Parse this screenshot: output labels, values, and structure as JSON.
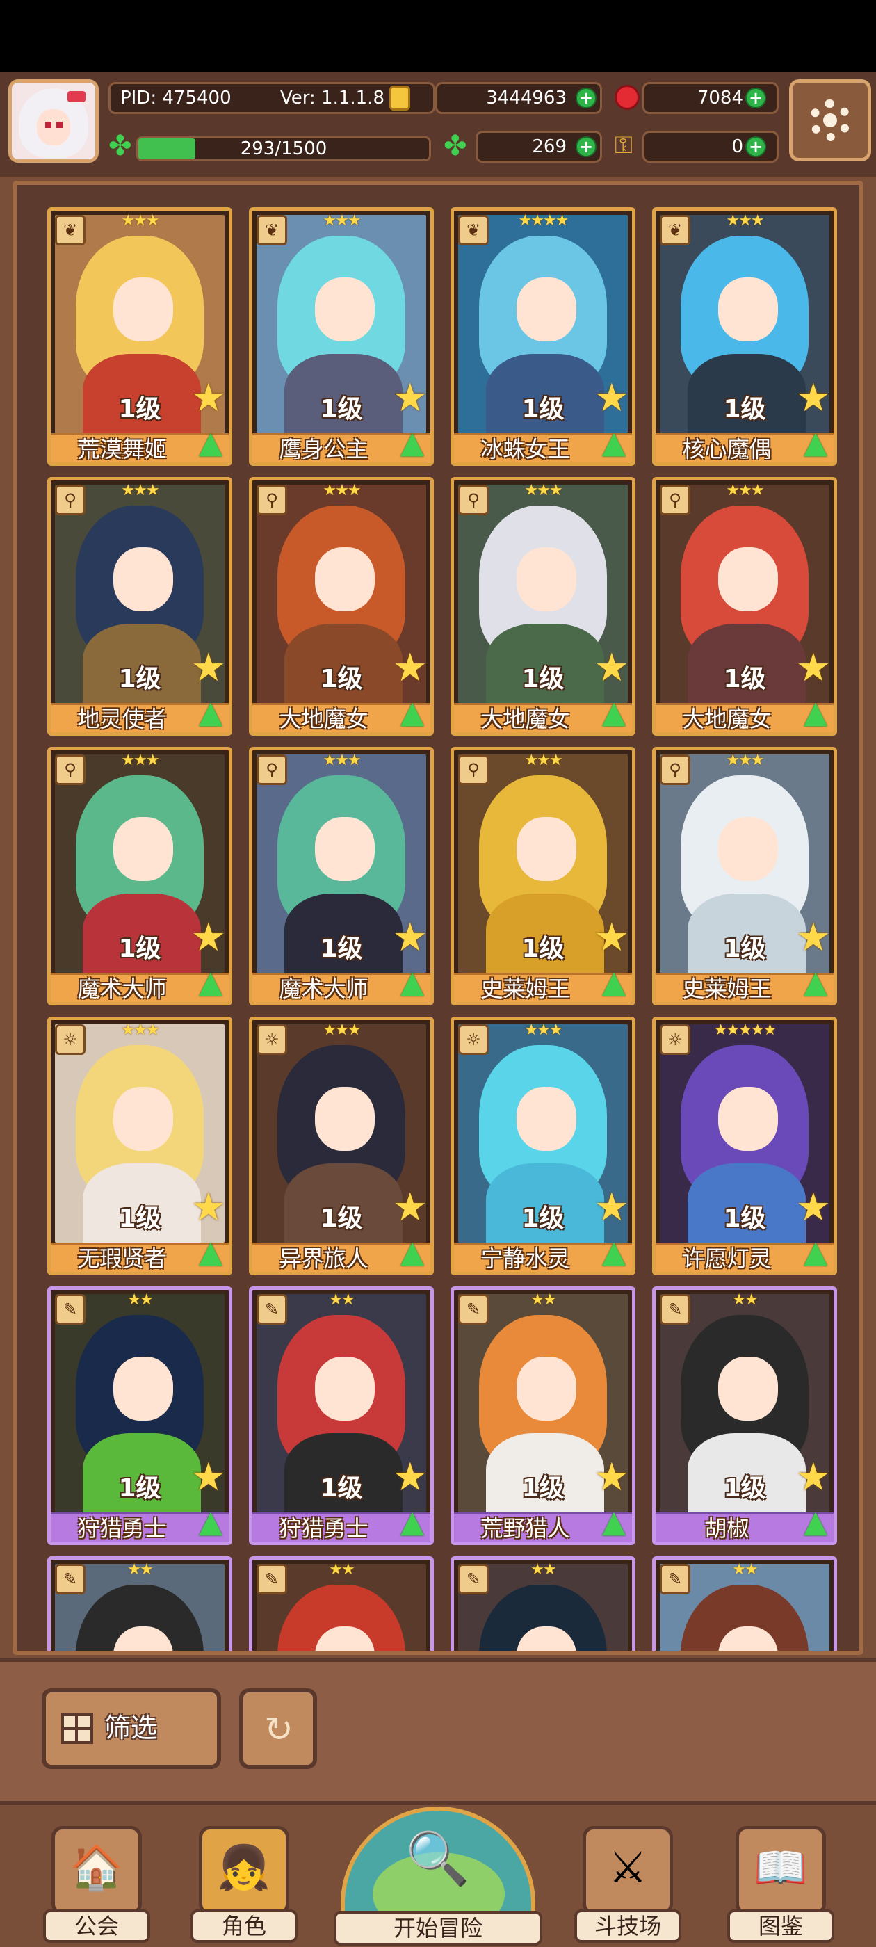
{
  "header": {
    "pid": "PID: 475400",
    "version": "Ver: 1.1.1.8",
    "gold": "3444963",
    "ruby": "7084",
    "xp": "293/1500",
    "xp_fraction": 0.195,
    "clover": "269",
    "keys": "0"
  },
  "characters": [
    {
      "name": "荒漠舞姬",
      "level": "1级",
      "stars": "★★★",
      "class_icon": "leaf-icon",
      "hair": "#f3c65a",
      "body": "#c8402e",
      "bg": "#b07a4a",
      "frame": "gold"
    },
    {
      "name": "鹰身公主",
      "level": "1级",
      "stars": "★★★",
      "class_icon": "leaf-icon",
      "hair": "#6fd8e0",
      "body": "#5a5e7a",
      "bg": "#6a8fb0",
      "frame": "gold"
    },
    {
      "name": "冰蛛女王",
      "level": "1级",
      "stars": "★★★★",
      "class_icon": "leaf-icon",
      "hair": "#6ac6e4",
      "body": "#3a5a8a",
      "bg": "#2e6f9a",
      "frame": "gold"
    },
    {
      "name": "核心魔偶",
      "level": "1级",
      "stars": "★★★",
      "class_icon": "leaf-icon",
      "hair": "#4ab8e8",
      "body": "#2a3a4a",
      "bg": "#3a4a5a",
      "frame": "gold"
    },
    {
      "name": "地灵使者",
      "level": "1级",
      "stars": "★★★",
      "class_icon": "wand-icon",
      "hair": "#2a3a5a",
      "body": "#8a6a3a",
      "bg": "#4a4a3a",
      "frame": "gold"
    },
    {
      "name": "大地魔女",
      "level": "1级",
      "stars": "★★★",
      "class_icon": "wand-icon",
      "hair": "#c85a2a",
      "body": "#8a4a2a",
      "bg": "#6a3a2a",
      "frame": "gold"
    },
    {
      "name": "大地魔女",
      "level": "1级",
      "stars": "★★★",
      "class_icon": "wand-icon",
      "hair": "#e0e0e8",
      "body": "#4a6a4a",
      "bg": "#4a5a4a",
      "frame": "gold"
    },
    {
      "name": "大地魔女",
      "level": "1级",
      "stars": "★★★",
      "class_icon": "wand-icon",
      "hair": "#d84a3a",
      "body": "#6a3a3a",
      "bg": "#5a3a2a",
      "frame": "gold"
    },
    {
      "name": "魔术大师",
      "level": "1级",
      "stars": "★★★",
      "class_icon": "wand-icon",
      "hair": "#5ab88a",
      "body": "#b8343a",
      "bg": "#4a3a2a",
      "frame": "gold"
    },
    {
      "name": "魔术大师",
      "level": "1级",
      "stars": "★★★",
      "class_icon": "wand-icon",
      "hair": "#5ab89a",
      "body": "#2a2a3a",
      "bg": "#5a6a8a",
      "frame": "gold"
    },
    {
      "name": "史莱姆王",
      "level": "1级",
      "stars": "★★★",
      "class_icon": "wand-icon",
      "hair": "#e8b83a",
      "body": "#d8a028",
      "bg": "#6a4a2a",
      "frame": "gold"
    },
    {
      "name": "史莱姆王",
      "level": "1级",
      "stars": "★★★",
      "class_icon": "wand-icon",
      "hair": "#e8eef2",
      "body": "#c8d4dc",
      "bg": "#6a7a8a",
      "frame": "gold"
    },
    {
      "name": "无瑕贤者",
      "level": "1级",
      "stars": "★★★",
      "class_icon": "sun-icon",
      "hair": "#f4d67a",
      "body": "#f0e6e0",
      "bg": "#d8c8b8",
      "frame": "gold"
    },
    {
      "name": "异界旅人",
      "level": "1级",
      "stars": "★★★",
      "class_icon": "sun-icon",
      "hair": "#2a2a3a",
      "body": "#6a4a3a",
      "bg": "#5a3a2a",
      "frame": "gold"
    },
    {
      "name": "宁静水灵",
      "level": "1级",
      "stars": "★★★",
      "class_icon": "sun-icon",
      "hair": "#5ad4e8",
      "body": "#4ab8d8",
      "bg": "#3a6a8a",
      "frame": "gold"
    },
    {
      "name": "许愿灯灵",
      "level": "1级",
      "stars": "★★★★★",
      "class_icon": "sun-icon",
      "hair": "#6a4ab8",
      "body": "#4a78c8",
      "bg": "#3a2a4a",
      "frame": "gold"
    },
    {
      "name": "狩猎勇士",
      "level": "1级",
      "stars": "★★",
      "class_icon": "feather-icon",
      "hair": "#1a2a4a",
      "body": "#5ab83a",
      "bg": "#3a3a2a",
      "frame": "purple"
    },
    {
      "name": "狩猎勇士",
      "level": "1级",
      "stars": "★★",
      "class_icon": "feather-icon",
      "hair": "#c83a3a",
      "body": "#2a2a2a",
      "bg": "#3a3a4a",
      "frame": "purple"
    },
    {
      "name": "荒野猎人",
      "level": "1级",
      "stars": "★★",
      "class_icon": "feather-icon",
      "hair": "#e88a3a",
      "body": "#f0ece8",
      "bg": "#5a4a3a",
      "frame": "purple"
    },
    {
      "name": "胡椒",
      "level": "1级",
      "stars": "★★",
      "class_icon": "feather-icon",
      "hair": "#2a2a2a",
      "body": "#e8e8e8",
      "bg": "#4a3a3a",
      "frame": "purple"
    },
    {
      "name": "",
      "level": "",
      "stars": "★★",
      "class_icon": "feather-icon",
      "hair": "#2a2a2a",
      "body": "#e8e8e8",
      "bg": "#5a6a7a",
      "frame": "purple"
    },
    {
      "name": "",
      "level": "",
      "stars": "★★",
      "class_icon": "feather-icon",
      "hair": "#c83a2a",
      "body": "#8a3a2a",
      "bg": "#5a3a2a",
      "frame": "purple"
    },
    {
      "name": "",
      "level": "",
      "stars": "★★",
      "class_icon": "feather-icon",
      "hair": "#1a2a3a",
      "body": "#4a4a5a",
      "bg": "#4a3a3a",
      "frame": "purple"
    },
    {
      "name": "",
      "level": "",
      "stars": "★★",
      "class_icon": "feather-icon",
      "hair": "#7a3a2a",
      "body": "#e8eef8",
      "bg": "#6a8aa8",
      "frame": "purple"
    }
  ],
  "toolbar": {
    "filter_label": "筛选"
  },
  "nav": {
    "guild": "公会",
    "characters": "角色",
    "adventure": "开始冒险",
    "arena": "斗技场",
    "codex": "图鉴"
  }
}
